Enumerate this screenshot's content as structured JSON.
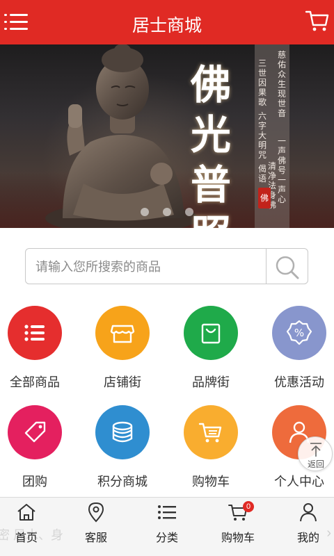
{
  "header": {
    "title": "居士商城",
    "menu_icon": "menu-icon",
    "cart_icon": "cart-icon"
  },
  "banner": {
    "calligraphy": [
      "佛",
      "光",
      "普",
      "照"
    ],
    "poem_columns": [
      "慈佑众生现世音",
      "一声佛号一声心",
      "清净法身佛",
      "三世因果歌",
      "六字大明咒",
      "偈语"
    ],
    "seal_text": "佛",
    "slide_count": 3,
    "active_slide": 1
  },
  "search": {
    "placeholder": "请输入您所搜索的商品",
    "icon": "search-icon"
  },
  "grid": [
    {
      "label": "全部商品",
      "color": "#e52e2e",
      "icon": "list-icon"
    },
    {
      "label": "店铺街",
      "color": "#f7a31a",
      "icon": "shop-icon"
    },
    {
      "label": "品牌街",
      "color": "#1faa4a",
      "icon": "bag-icon"
    },
    {
      "label": "优惠活动",
      "color": "#8896cd",
      "icon": "percent-tag-icon"
    },
    {
      "label": "团购",
      "color": "#e4205f",
      "icon": "price-tag-icon"
    },
    {
      "label": "积分商城",
      "color": "#2f8ed0",
      "icon": "coins-icon"
    },
    {
      "label": "购物车",
      "color": "#f9ad2f",
      "icon": "cart-icon"
    },
    {
      "label": "个人中心",
      "color": "#ee6b3c",
      "icon": "person-icon"
    }
  ],
  "back_to_top": {
    "label": "返回",
    "icon": "arrow-up-icon"
  },
  "tabbar": {
    "ghost_text": "密  风水、身",
    "items": [
      {
        "label": "首页",
        "icon": "home-icon"
      },
      {
        "label": "客服",
        "icon": "location-pin-icon"
      },
      {
        "label": "分类",
        "icon": "list-icon"
      },
      {
        "label": "购物车",
        "icon": "cart-icon",
        "badge": "0"
      },
      {
        "label": "我的",
        "icon": "person-icon"
      }
    ]
  }
}
